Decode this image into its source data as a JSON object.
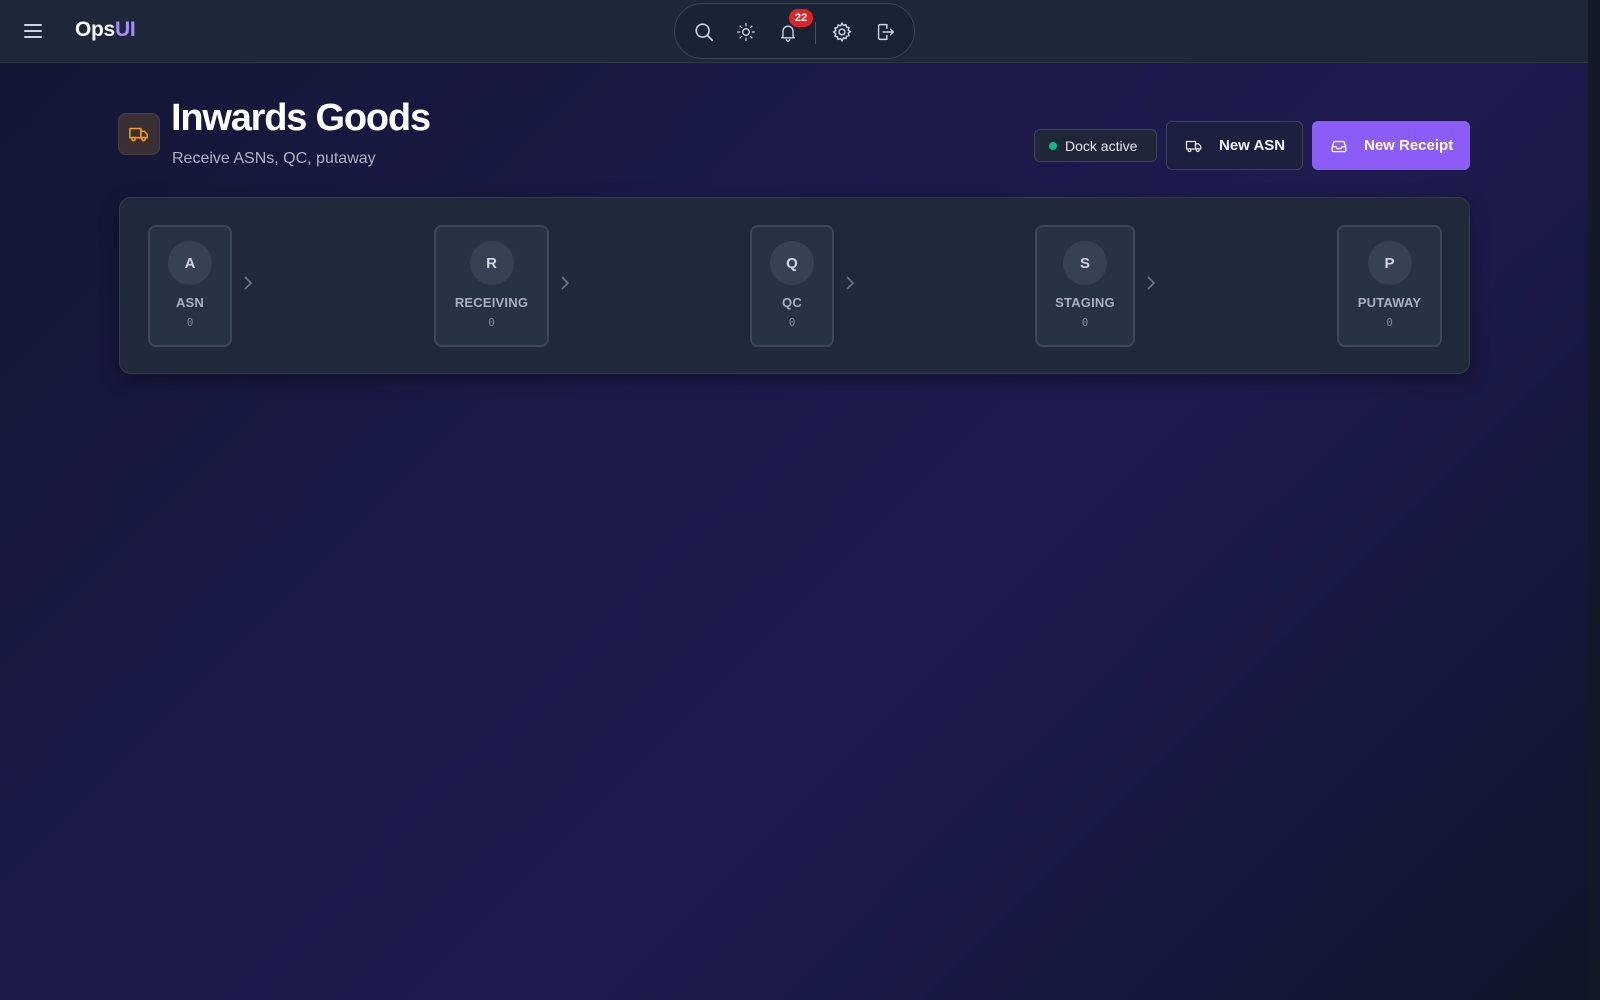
{
  "app": {
    "brand_part1": "Ops",
    "brand_part2": "UI"
  },
  "toolbar": {
    "icons": [
      "search-icon",
      "sun-icon",
      "bell-icon",
      "settings-icon",
      "logout-icon"
    ],
    "notification_count": "22"
  },
  "header": {
    "title": "Inwards Goods",
    "subtitle": "Receive ASNs, QC, putaway",
    "icon": "truck-icon",
    "status_label": "Dock active",
    "status_color": "#10b981",
    "new_asn_label": "New ASN",
    "new_receipt_label": "New Receipt",
    "accent_color": "#8b5cf6"
  },
  "pipeline": {
    "stages": [
      {
        "initial": "A",
        "label": "ASN",
        "count": "0"
      },
      {
        "initial": "R",
        "label": "RECEIVING",
        "count": "0"
      },
      {
        "initial": "Q",
        "label": "QC",
        "count": "0"
      },
      {
        "initial": "S",
        "label": "STAGING",
        "count": "0"
      },
      {
        "initial": "P",
        "label": "PUTAWAY",
        "count": "0"
      }
    ]
  }
}
